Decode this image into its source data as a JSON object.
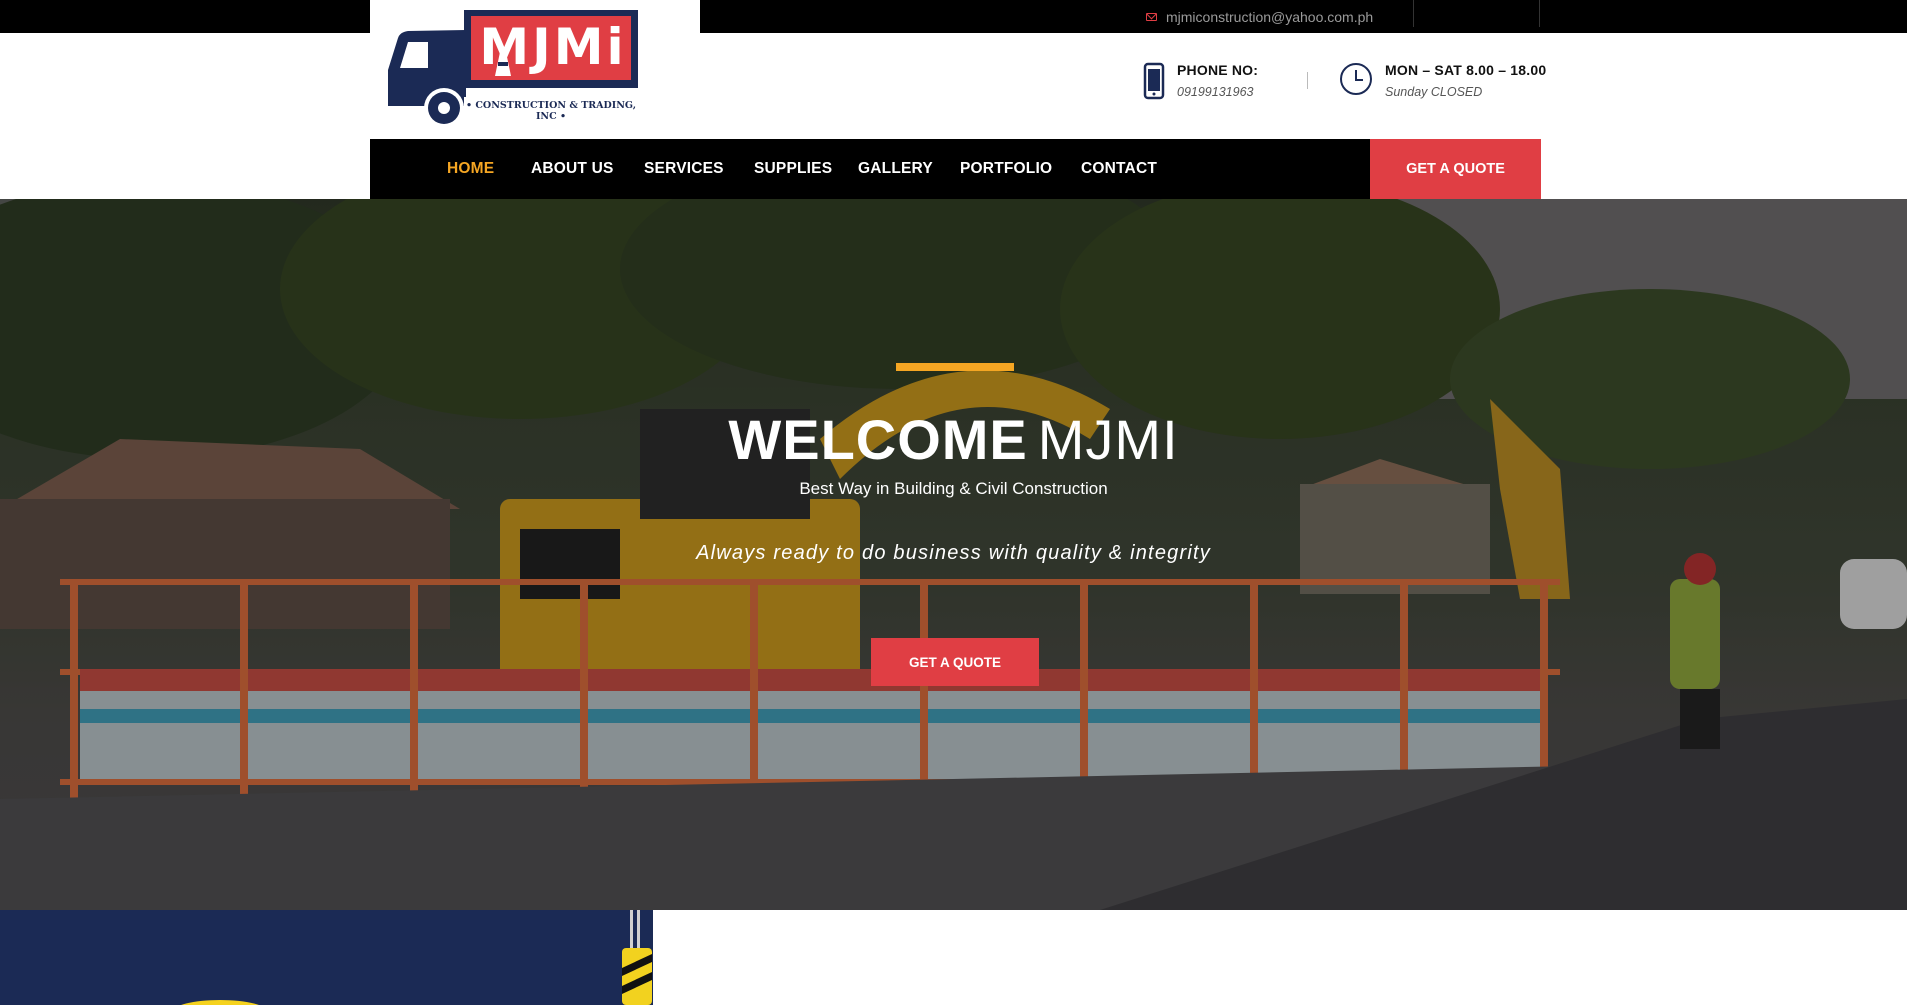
{
  "top_bar": {
    "email": "mjmiconstruction@yahoo.com.ph",
    "email_icon": "envelope-icon"
  },
  "logo": {
    "brand": "MJMi",
    "tagline": "• CONSTRUCTION & TRADING, INC •"
  },
  "header": {
    "phone_label": "PHONE NO:",
    "phone_number": "09199131963",
    "phone_icon": "mobile-phone-icon",
    "hours_label": "MON – SAT 8.00 – 18.00",
    "hours_note": "Sunday CLOSED",
    "hours_icon": "clock-icon"
  },
  "nav": {
    "items": [
      {
        "label": "HOME",
        "active": true
      },
      {
        "label": "ABOUT US",
        "active": false
      },
      {
        "label": "SERVICES",
        "active": false
      },
      {
        "label": "SUPPLIES",
        "active": false
      },
      {
        "label": "GALLERY",
        "active": false
      },
      {
        "label": "PORTFOLIO",
        "active": false
      },
      {
        "label": "CONTACT",
        "active": false
      }
    ],
    "cta_label": "GET A QUOTE"
  },
  "hero": {
    "title_bold": "WELCOME",
    "title_light": "MJMI",
    "subtitle": "Best Way in Building & Civil Construction",
    "tagline": "Always ready to do business with quality & integrity",
    "cta_label": "GET A QUOTE",
    "background": "construction-site-photo"
  },
  "colors": {
    "accent_red": "#e03e44",
    "accent_orange": "#f5a623",
    "dark": "#000000",
    "navy": "#1b2a55"
  }
}
